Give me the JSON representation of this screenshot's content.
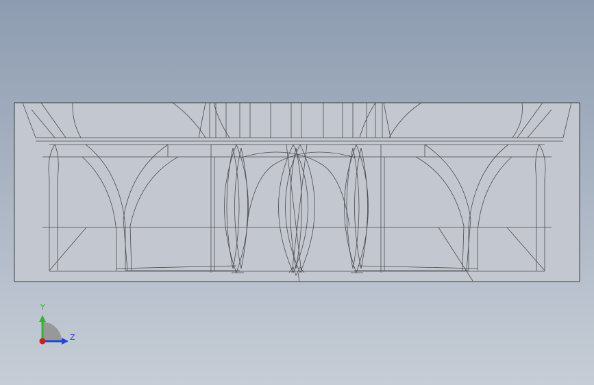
{
  "viewport": {
    "background_top": "#8d9cb0",
    "background_bottom": "#c6cdd6",
    "part_fill": "#c3c8d0",
    "edge_color": "#4a4a4a"
  },
  "model": {
    "view": "front",
    "display_mode": "wireframe"
  },
  "triad": {
    "y_label": "Y",
    "z_label": "Z",
    "x_color": "#cc1e1e",
    "y_color": "#2fb52f",
    "z_color": "#2146d6"
  }
}
